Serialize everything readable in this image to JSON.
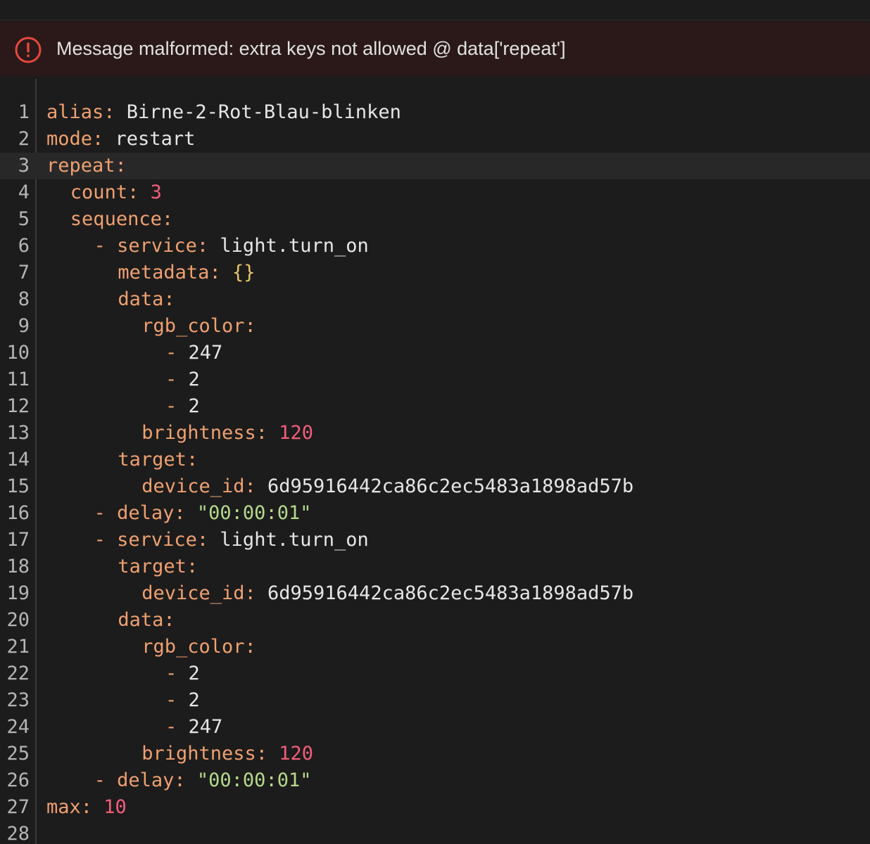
{
  "alert": {
    "message": "Message malformed: extra keys not allowed @ data['repeat']",
    "icon": "alert-circle-icon",
    "color": "#e5483d"
  },
  "editor": {
    "active_line": 3,
    "lines": [
      {
        "n": "1",
        "indent": 0,
        "tokens": [
          {
            "t": "key",
            "v": "alias"
          },
          {
            "t": "punct",
            "v": ": "
          },
          {
            "t": "text",
            "v": "Birne-2-Rot-Blau-blinken"
          }
        ]
      },
      {
        "n": "2",
        "indent": 0,
        "tokens": [
          {
            "t": "key",
            "v": "mode"
          },
          {
            "t": "punct",
            "v": ": "
          },
          {
            "t": "text",
            "v": "restart"
          }
        ]
      },
      {
        "n": "3",
        "indent": 0,
        "tokens": [
          {
            "t": "key",
            "v": "repeat"
          },
          {
            "t": "punct",
            "v": ":"
          }
        ]
      },
      {
        "n": "4",
        "indent": 2,
        "tokens": [
          {
            "t": "key",
            "v": "count"
          },
          {
            "t": "punct",
            "v": ": "
          },
          {
            "t": "num",
            "v": "3"
          }
        ]
      },
      {
        "n": "5",
        "indent": 2,
        "tokens": [
          {
            "t": "key",
            "v": "sequence"
          },
          {
            "t": "punct",
            "v": ":"
          }
        ]
      },
      {
        "n": "6",
        "indent": 4,
        "tokens": [
          {
            "t": "dash",
            "v": "- "
          },
          {
            "t": "key",
            "v": "service"
          },
          {
            "t": "punct",
            "v": ": "
          },
          {
            "t": "text",
            "v": "light.turn_on"
          }
        ]
      },
      {
        "n": "7",
        "indent": 6,
        "tokens": [
          {
            "t": "key",
            "v": "metadata"
          },
          {
            "t": "punct",
            "v": ": "
          },
          {
            "t": "brace",
            "v": "{}"
          }
        ]
      },
      {
        "n": "8",
        "indent": 6,
        "tokens": [
          {
            "t": "key",
            "v": "data"
          },
          {
            "t": "punct",
            "v": ":"
          }
        ]
      },
      {
        "n": "9",
        "indent": 8,
        "tokens": [
          {
            "t": "key",
            "v": "rgb_color"
          },
          {
            "t": "punct",
            "v": ":"
          }
        ]
      },
      {
        "n": "10",
        "indent": 10,
        "tokens": [
          {
            "t": "dash",
            "v": "- "
          },
          {
            "t": "text",
            "v": "247"
          }
        ]
      },
      {
        "n": "11",
        "indent": 10,
        "tokens": [
          {
            "t": "dash",
            "v": "- "
          },
          {
            "t": "text",
            "v": "2"
          }
        ]
      },
      {
        "n": "12",
        "indent": 10,
        "tokens": [
          {
            "t": "dash",
            "v": "- "
          },
          {
            "t": "text",
            "v": "2"
          }
        ]
      },
      {
        "n": "13",
        "indent": 8,
        "tokens": [
          {
            "t": "key",
            "v": "brightness"
          },
          {
            "t": "punct",
            "v": ": "
          },
          {
            "t": "num",
            "v": "120"
          }
        ]
      },
      {
        "n": "14",
        "indent": 6,
        "tokens": [
          {
            "t": "key",
            "v": "target"
          },
          {
            "t": "punct",
            "v": ":"
          }
        ]
      },
      {
        "n": "15",
        "indent": 8,
        "tokens": [
          {
            "t": "key",
            "v": "device_id"
          },
          {
            "t": "punct",
            "v": ": "
          },
          {
            "t": "text",
            "v": "6d95916442ca86c2ec5483a1898ad57b"
          }
        ]
      },
      {
        "n": "16",
        "indent": 4,
        "tokens": [
          {
            "t": "dash",
            "v": "- "
          },
          {
            "t": "key",
            "v": "delay"
          },
          {
            "t": "punct",
            "v": ": "
          },
          {
            "t": "str",
            "v": "\"00:00:01\""
          }
        ]
      },
      {
        "n": "17",
        "indent": 4,
        "tokens": [
          {
            "t": "dash",
            "v": "- "
          },
          {
            "t": "key",
            "v": "service"
          },
          {
            "t": "punct",
            "v": ": "
          },
          {
            "t": "text",
            "v": "light.turn_on"
          }
        ]
      },
      {
        "n": "18",
        "indent": 6,
        "tokens": [
          {
            "t": "key",
            "v": "target"
          },
          {
            "t": "punct",
            "v": ":"
          }
        ]
      },
      {
        "n": "19",
        "indent": 8,
        "tokens": [
          {
            "t": "key",
            "v": "device_id"
          },
          {
            "t": "punct",
            "v": ": "
          },
          {
            "t": "text",
            "v": "6d95916442ca86c2ec5483a1898ad57b"
          }
        ]
      },
      {
        "n": "20",
        "indent": 6,
        "tokens": [
          {
            "t": "key",
            "v": "data"
          },
          {
            "t": "punct",
            "v": ":"
          }
        ]
      },
      {
        "n": "21",
        "indent": 8,
        "tokens": [
          {
            "t": "key",
            "v": "rgb_color"
          },
          {
            "t": "punct",
            "v": ":"
          }
        ]
      },
      {
        "n": "22",
        "indent": 10,
        "tokens": [
          {
            "t": "dash",
            "v": "- "
          },
          {
            "t": "text",
            "v": "2"
          }
        ]
      },
      {
        "n": "23",
        "indent": 10,
        "tokens": [
          {
            "t": "dash",
            "v": "- "
          },
          {
            "t": "text",
            "v": "2"
          }
        ]
      },
      {
        "n": "24",
        "indent": 10,
        "tokens": [
          {
            "t": "dash",
            "v": "- "
          },
          {
            "t": "text",
            "v": "247"
          }
        ]
      },
      {
        "n": "25",
        "indent": 8,
        "tokens": [
          {
            "t": "key",
            "v": "brightness"
          },
          {
            "t": "punct",
            "v": ": "
          },
          {
            "t": "num",
            "v": "120"
          }
        ]
      },
      {
        "n": "26",
        "indent": 4,
        "tokens": [
          {
            "t": "dash",
            "v": "- "
          },
          {
            "t": "key",
            "v": "delay"
          },
          {
            "t": "punct",
            "v": ": "
          },
          {
            "t": "str",
            "v": "\"00:00:01\""
          }
        ]
      },
      {
        "n": "27",
        "indent": 0,
        "tokens": [
          {
            "t": "key",
            "v": "max"
          },
          {
            "t": "punct",
            "v": ": "
          },
          {
            "t": "num",
            "v": "10"
          }
        ]
      },
      {
        "n": "28",
        "indent": 0,
        "tokens": []
      }
    ]
  }
}
